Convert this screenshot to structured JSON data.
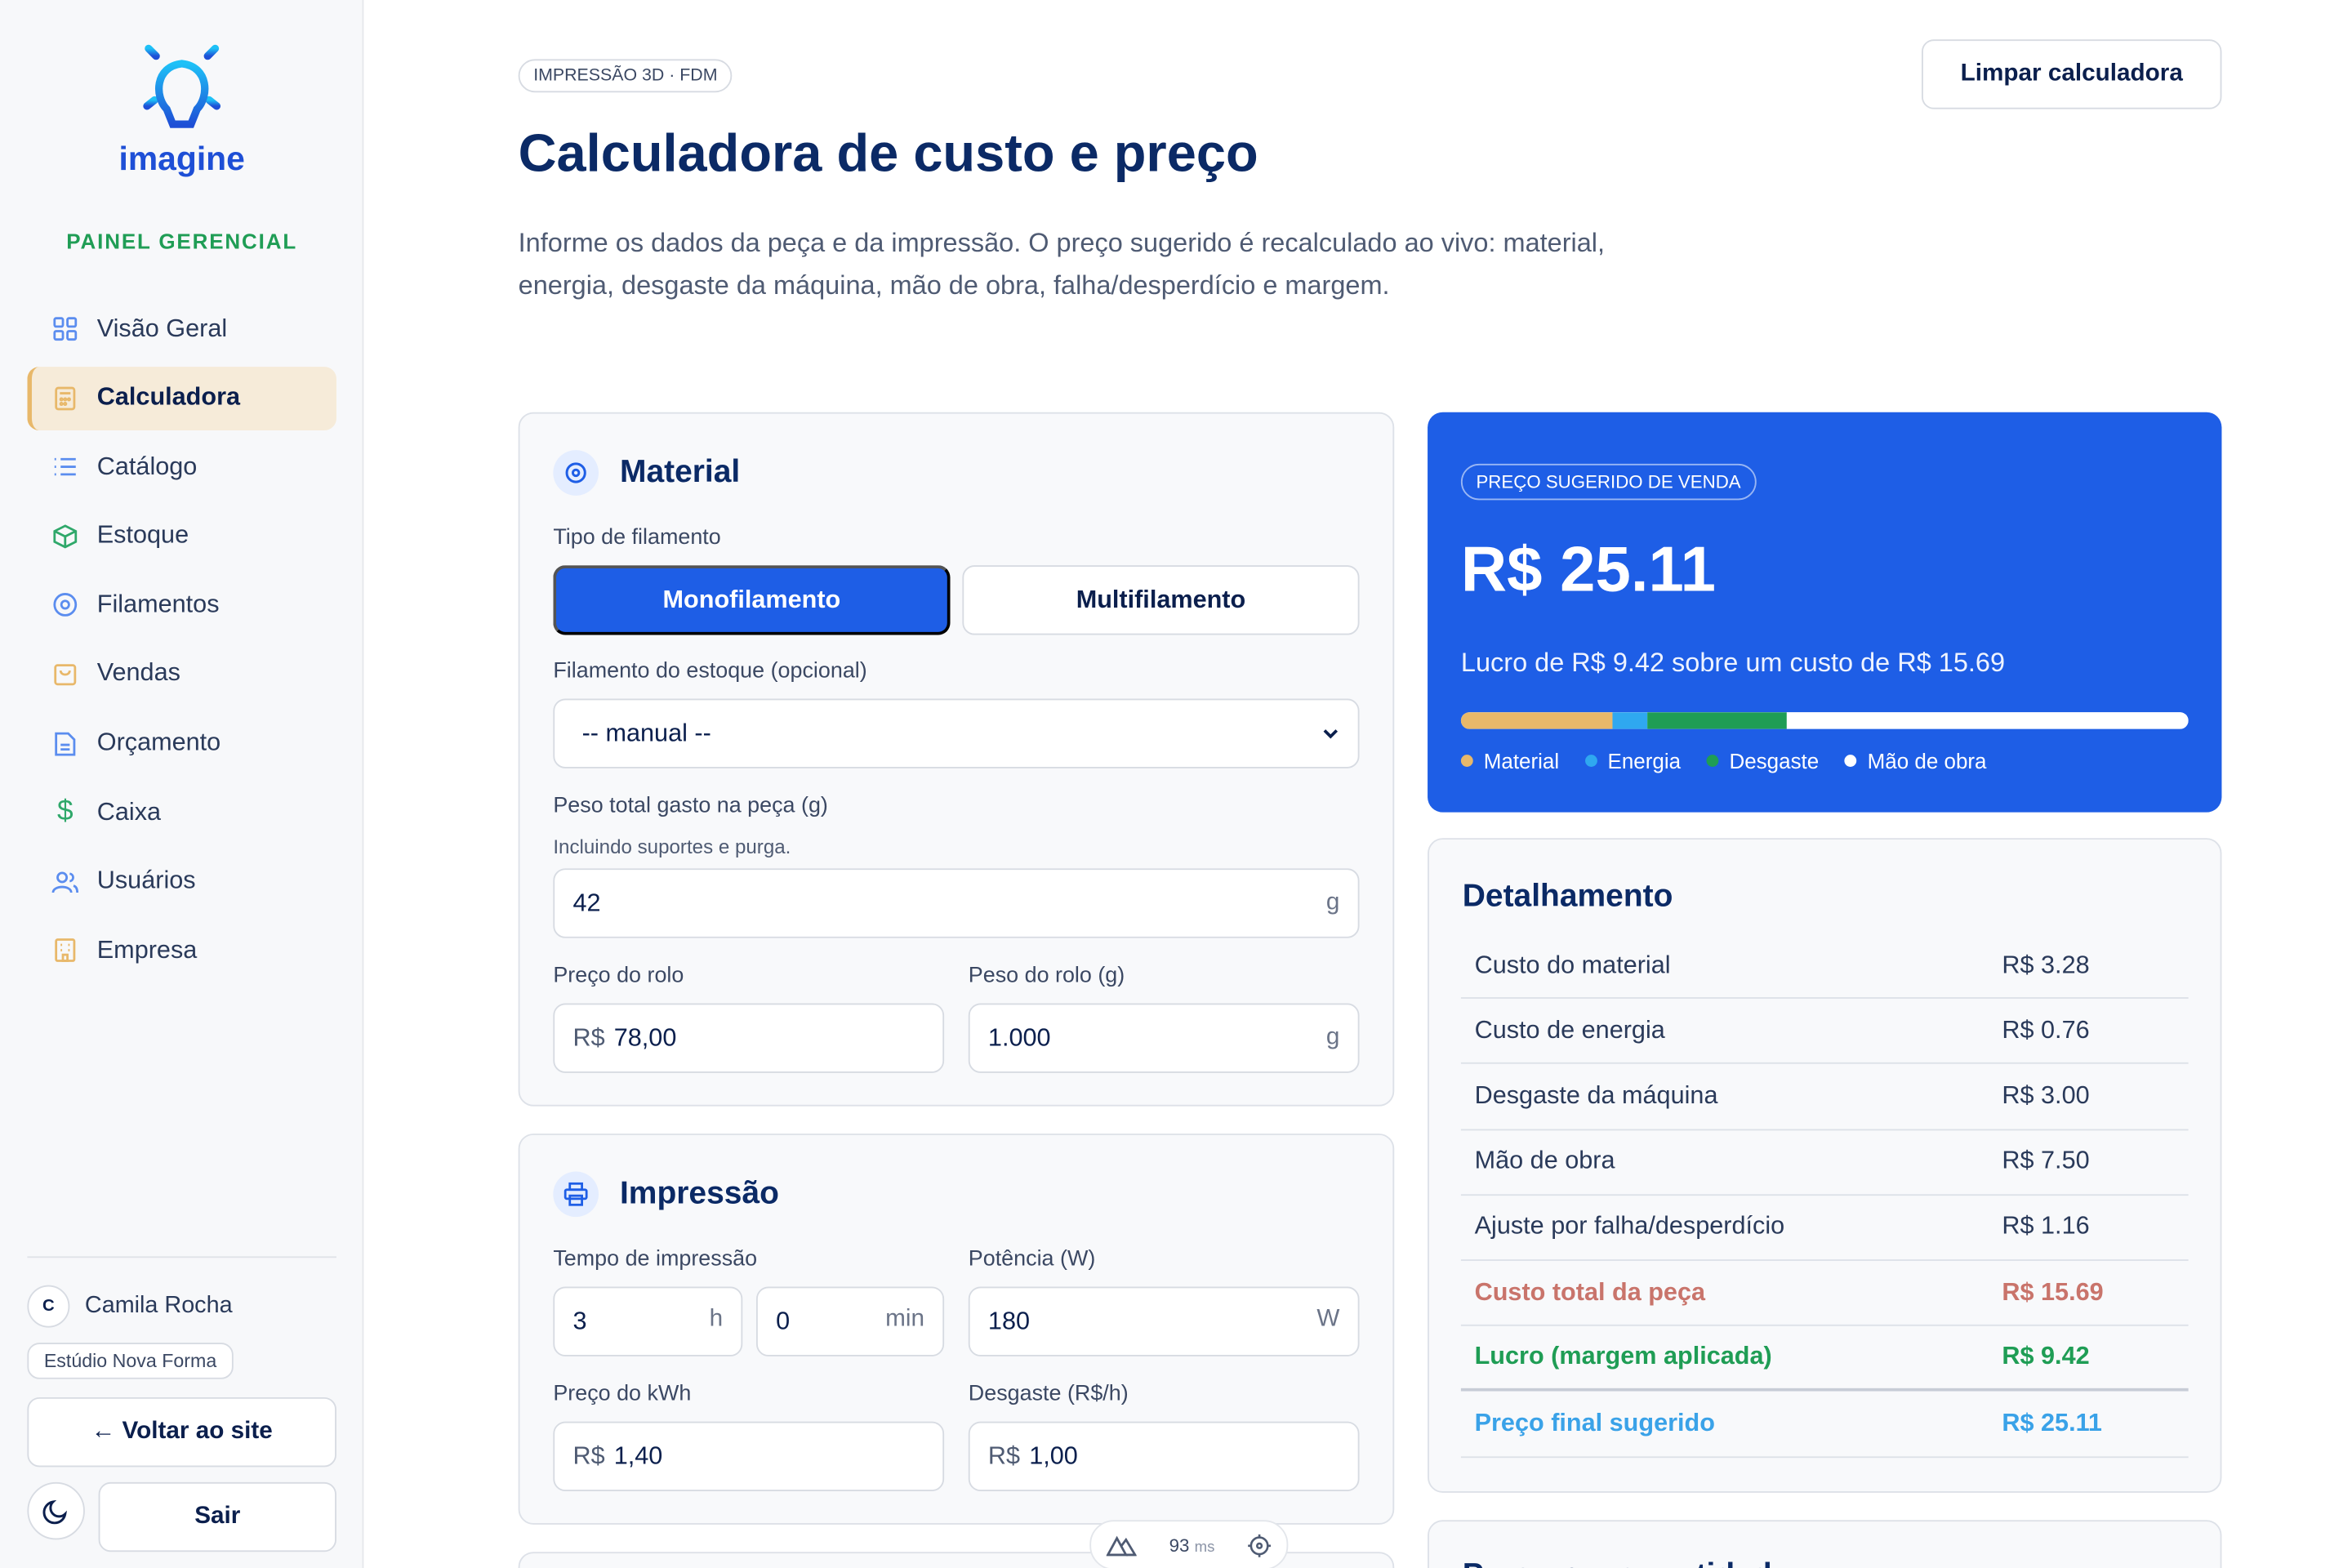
{
  "brand": {
    "name": "imagine",
    "panel_label": "PAINEL GERENCIAL"
  },
  "sidebar": {
    "items": [
      {
        "label": "Visão Geral",
        "icon": "grid-icon"
      },
      {
        "label": "Calculadora",
        "icon": "calculator-icon",
        "active": true
      },
      {
        "label": "Catálogo",
        "icon": "list-icon"
      },
      {
        "label": "Estoque",
        "icon": "box-icon"
      },
      {
        "label": "Filamentos",
        "icon": "spool-icon"
      },
      {
        "label": "Vendas",
        "icon": "shopping-bag-icon"
      },
      {
        "label": "Orçamento",
        "icon": "document-icon"
      },
      {
        "label": "Caixa",
        "icon": "dollar-icon"
      },
      {
        "label": "Usuários",
        "icon": "users-icon"
      },
      {
        "label": "Empresa",
        "icon": "building-icon"
      }
    ],
    "user": {
      "initial": "C",
      "name": "Camila Rocha",
      "company": "Estúdio Nova Forma"
    },
    "back_label": "← Voltar ao site",
    "logout_label": "Sair"
  },
  "header": {
    "tag": "IMPRESSÃO 3D · FDM",
    "title": "Calculadora de custo e preço",
    "description": "Informe os dados da peça e da impressão. O preço sugerido é recalculado ao vivo: material, energia, desgaste da máquina, mão de obra, falha/desperdício e margem.",
    "clear_label": "Limpar calculadora"
  },
  "material": {
    "title": "Material",
    "filament_type_label": "Tipo de filamento",
    "mono_label": "Monofilamento",
    "multi_label": "Multifilamento",
    "stock_label": "Filamento do estoque (opcional)",
    "stock_value": "-- manual --",
    "weight_label": "Peso total gasto na peça (g)",
    "weight_hint": "Incluindo suportes e purga.",
    "weight_value": "42",
    "weight_unit": "g",
    "roll_price_label": "Preço do rolo",
    "roll_price_prefix": "R$",
    "roll_price_value": "78,00",
    "roll_weight_label": "Peso do rolo (g)",
    "roll_weight_value": "1.000",
    "roll_weight_unit": "g"
  },
  "impressao": {
    "title": "Impressão",
    "time_label": "Tempo de impressão",
    "hours_value": "3",
    "hours_unit": "h",
    "minutes_value": "0",
    "minutes_unit": "min",
    "power_label": "Potência (W)",
    "power_value": "180",
    "power_unit": "W",
    "kwh_label": "Preço do kWh",
    "kwh_prefix": "R$",
    "kwh_value": "1,40",
    "wear_label": "Desgaste (R$/h)",
    "wear_prefix": "R$",
    "wear_value": "1,00"
  },
  "price": {
    "tag": "PREÇO SUGERIDO DE VENDA",
    "value": "R$ 25.11",
    "subtitle": "Lucro de R$ 9.42 sobre um custo de R$ 15.69",
    "bar": [
      {
        "name": "Material",
        "fraction": 0.209,
        "color": "#e8b86a"
      },
      {
        "name": "Energia",
        "fraction": 0.048,
        "color": "#2fa8f0"
      },
      {
        "name": "Desgaste",
        "fraction": 0.191,
        "color": "#1f9d55"
      },
      {
        "name": "Mão de obra",
        "fraction": 0.552,
        "color": "#ffffff"
      }
    ],
    "legend": [
      "Material",
      "Energia",
      "Desgaste",
      "Mão de obra"
    ]
  },
  "detail": {
    "title": "Detalhamento",
    "rows": [
      {
        "label": "Custo do material",
        "value": "R$ 3.28"
      },
      {
        "label": "Custo de energia",
        "value": "R$ 0.76"
      },
      {
        "label": "Desgaste da máquina",
        "value": "R$ 3.00"
      },
      {
        "label": "Mão de obra",
        "value": "R$ 7.50"
      },
      {
        "label": "Ajuste por falha/desperdício",
        "value": "R$ 1.16"
      },
      {
        "label": "Custo total da peça",
        "value": "R$ 15.69"
      },
      {
        "label": "Lucro (margem aplicada)",
        "value": "R$ 9.42"
      },
      {
        "label": "Preço final sugerido",
        "value": "R$ 25.11"
      }
    ]
  },
  "quantity": {
    "title": "Preço por quantidade"
  },
  "dev_indicator": {
    "value": "93",
    "unit": "ms"
  },
  "colors": {
    "accent": "#1e5ee6",
    "brand_green": "#1f9d55",
    "active_bg": "#f6ebd9"
  }
}
